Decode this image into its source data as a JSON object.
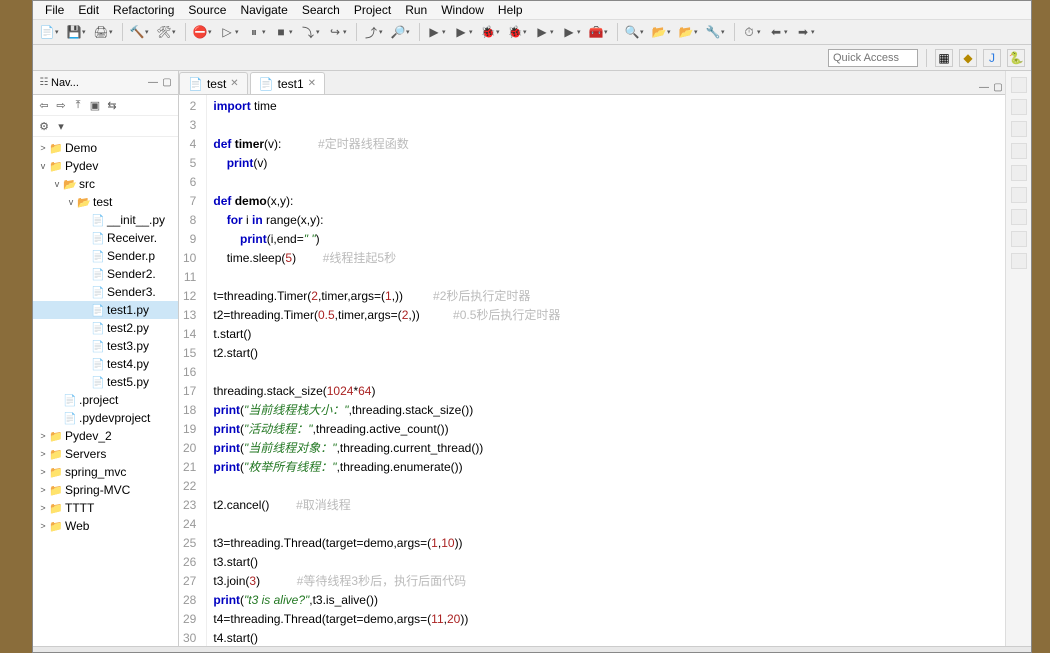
{
  "menu": {
    "items": [
      "File",
      "Edit",
      "Refactoring",
      "Source",
      "Navigate",
      "Search",
      "Project",
      "Run",
      "Window",
      "Help"
    ]
  },
  "quick_access": {
    "placeholder": "Quick Access"
  },
  "navigator": {
    "title": "Nav...",
    "tree": [
      {
        "depth": 0,
        "twisty": ">",
        "icon": "📁",
        "label": "Demo"
      },
      {
        "depth": 0,
        "twisty": "v",
        "icon": "📁",
        "label": "Pydev"
      },
      {
        "depth": 1,
        "twisty": "v",
        "icon": "📂",
        "label": "src"
      },
      {
        "depth": 2,
        "twisty": "v",
        "icon": "📂",
        "label": "test"
      },
      {
        "depth": 3,
        "twisty": "",
        "icon": "📄",
        "label": "__init__.py"
      },
      {
        "depth": 3,
        "twisty": "",
        "icon": "📄",
        "label": "Receiver."
      },
      {
        "depth": 3,
        "twisty": "",
        "icon": "📄",
        "label": "Sender.p"
      },
      {
        "depth": 3,
        "twisty": "",
        "icon": "📄",
        "label": "Sender2."
      },
      {
        "depth": 3,
        "twisty": "",
        "icon": "📄",
        "label": "Sender3."
      },
      {
        "depth": 3,
        "twisty": "",
        "icon": "📄",
        "label": "test1.py",
        "sel": true
      },
      {
        "depth": 3,
        "twisty": "",
        "icon": "📄",
        "label": "test2.py"
      },
      {
        "depth": 3,
        "twisty": "",
        "icon": "📄",
        "label": "test3.py"
      },
      {
        "depth": 3,
        "twisty": "",
        "icon": "📄",
        "label": "test4.py"
      },
      {
        "depth": 3,
        "twisty": "",
        "icon": "📄",
        "label": "test5.py"
      },
      {
        "depth": 1,
        "twisty": "",
        "icon": "📄",
        "label": ".project"
      },
      {
        "depth": 1,
        "twisty": "",
        "icon": "📄",
        "label": ".pydevproject"
      },
      {
        "depth": 0,
        "twisty": ">",
        "icon": "📁",
        "label": "Pydev_2"
      },
      {
        "depth": 0,
        "twisty": ">",
        "icon": "📁",
        "label": "Servers"
      },
      {
        "depth": 0,
        "twisty": ">",
        "icon": "📁",
        "label": "spring_mvc"
      },
      {
        "depth": 0,
        "twisty": ">",
        "icon": "📁",
        "label": "Spring-MVC"
      },
      {
        "depth": 0,
        "twisty": ">",
        "icon": "📁",
        "label": "TTTT"
      },
      {
        "depth": 0,
        "twisty": ">",
        "icon": "📁",
        "label": "Web"
      }
    ]
  },
  "editor": {
    "tabs": [
      {
        "label": "test",
        "active": false
      },
      {
        "label": "test1",
        "active": true
      }
    ],
    "first_line_no": 2,
    "lines": [
      {
        "tokens": [
          [
            "kw",
            "import"
          ],
          [
            "",
            " time"
          ]
        ]
      },
      {
        "tokens": []
      },
      {
        "tokens": [
          [
            "kw",
            "def "
          ],
          [
            "fn",
            "timer"
          ],
          [
            "",
            "(v):           "
          ],
          [
            "cmt",
            "#定时器线程函数"
          ]
        ]
      },
      {
        "tokens": [
          [
            "",
            "    "
          ],
          [
            "kw",
            "print"
          ],
          [
            "",
            "(v)"
          ]
        ]
      },
      {
        "tokens": []
      },
      {
        "tokens": [
          [
            "kw",
            "def "
          ],
          [
            "fn",
            "demo"
          ],
          [
            "",
            "(x,y):"
          ]
        ]
      },
      {
        "tokens": [
          [
            "",
            "    "
          ],
          [
            "kw",
            "for"
          ],
          [
            "",
            " i "
          ],
          [
            "kw",
            "in"
          ],
          [
            "",
            " range(x,y):"
          ]
        ]
      },
      {
        "tokens": [
          [
            "",
            "        "
          ],
          [
            "kw",
            "print"
          ],
          [
            "",
            "(i,end="
          ],
          [
            "str",
            "\" \""
          ],
          [
            "",
            ")"
          ]
        ]
      },
      {
        "tokens": [
          [
            "",
            "    time.sleep("
          ],
          [
            "num",
            "5"
          ],
          [
            "",
            ")        "
          ],
          [
            "cmt",
            "#线程挂起5秒"
          ]
        ]
      },
      {
        "tokens": []
      },
      {
        "tokens": [
          [
            "",
            "t=threading.Timer("
          ],
          [
            "num",
            "2"
          ],
          [
            "",
            ",timer,args=("
          ],
          [
            "num",
            "1"
          ],
          [
            "",
            ",))         "
          ],
          [
            "cmt",
            "#2秒后执行定时器"
          ]
        ]
      },
      {
        "tokens": [
          [
            "",
            "t2=threading.Timer("
          ],
          [
            "num",
            "0.5"
          ],
          [
            "",
            ",timer,args=("
          ],
          [
            "num",
            "2"
          ],
          [
            "",
            ",))          "
          ],
          [
            "cmt",
            "#0.5秒后执行定时器"
          ]
        ]
      },
      {
        "tokens": [
          [
            "",
            "t.start()"
          ]
        ]
      },
      {
        "tokens": [
          [
            "",
            "t2.start()"
          ]
        ]
      },
      {
        "tokens": []
      },
      {
        "tokens": [
          [
            "",
            "threading.stack_size("
          ],
          [
            "num",
            "1024"
          ],
          [
            "",
            "*"
          ],
          [
            "num",
            "64"
          ],
          [
            "",
            ")"
          ]
        ]
      },
      {
        "tokens": [
          [
            "kw",
            "print"
          ],
          [
            "",
            "("
          ],
          [
            "str",
            "\"当前线程栈大小：\""
          ],
          [
            "",
            ",threading.stack_size())"
          ]
        ]
      },
      {
        "tokens": [
          [
            "kw",
            "print"
          ],
          [
            "",
            "("
          ],
          [
            "str",
            "\"活动线程：\""
          ],
          [
            "",
            ",threading.active_count())"
          ]
        ]
      },
      {
        "tokens": [
          [
            "kw",
            "print"
          ],
          [
            "",
            "("
          ],
          [
            "str",
            "\"当前线程对象：\""
          ],
          [
            "",
            ",threading.current_thread())"
          ]
        ]
      },
      {
        "tokens": [
          [
            "kw",
            "print"
          ],
          [
            "",
            "("
          ],
          [
            "str",
            "\"枚举所有线程：\""
          ],
          [
            "",
            ",threading.enumerate())"
          ]
        ]
      },
      {
        "tokens": []
      },
      {
        "tokens": [
          [
            "",
            "t2.cancel()        "
          ],
          [
            "cmt",
            "#取消线程"
          ]
        ]
      },
      {
        "tokens": []
      },
      {
        "tokens": [
          [
            "",
            "t3=threading.Thread(target=demo,args=("
          ],
          [
            "num",
            "1"
          ],
          [
            "",
            ","
          ],
          [
            "num",
            "10"
          ],
          [
            "",
            "))"
          ]
        ]
      },
      {
        "tokens": [
          [
            "",
            "t3.start()"
          ]
        ]
      },
      {
        "tokens": [
          [
            "",
            "t3.join("
          ],
          [
            "num",
            "3"
          ],
          [
            "",
            ")           "
          ],
          [
            "cmt",
            "#等待线程3秒后，执行后面代码"
          ]
        ]
      },
      {
        "tokens": [
          [
            "kw",
            "print"
          ],
          [
            "",
            "("
          ],
          [
            "str",
            "\"t3 is alive?\""
          ],
          [
            "",
            ",t3.is_alive())"
          ]
        ]
      },
      {
        "tokens": [
          [
            "",
            "t4=threading.Thread(target=demo,args=("
          ],
          [
            "num",
            "11"
          ],
          [
            "",
            ","
          ],
          [
            "num",
            "20"
          ],
          [
            "",
            "))"
          ]
        ]
      },
      {
        "tokens": [
          [
            "",
            "t4.start()"
          ]
        ]
      }
    ]
  },
  "toolbar_icons": [
    "📄",
    "💾",
    "🖨",
    "🔨",
    "🛠",
    "⛔",
    "▷",
    "⏸",
    "■",
    "⤵",
    "↪",
    "⤴",
    "🔎",
    "▶",
    "▶",
    "🐞",
    "🐞",
    "▶",
    "▶",
    "🧰",
    "🔍",
    "📂",
    "📂",
    "🔧",
    "⏱",
    "⬅",
    "➡"
  ]
}
